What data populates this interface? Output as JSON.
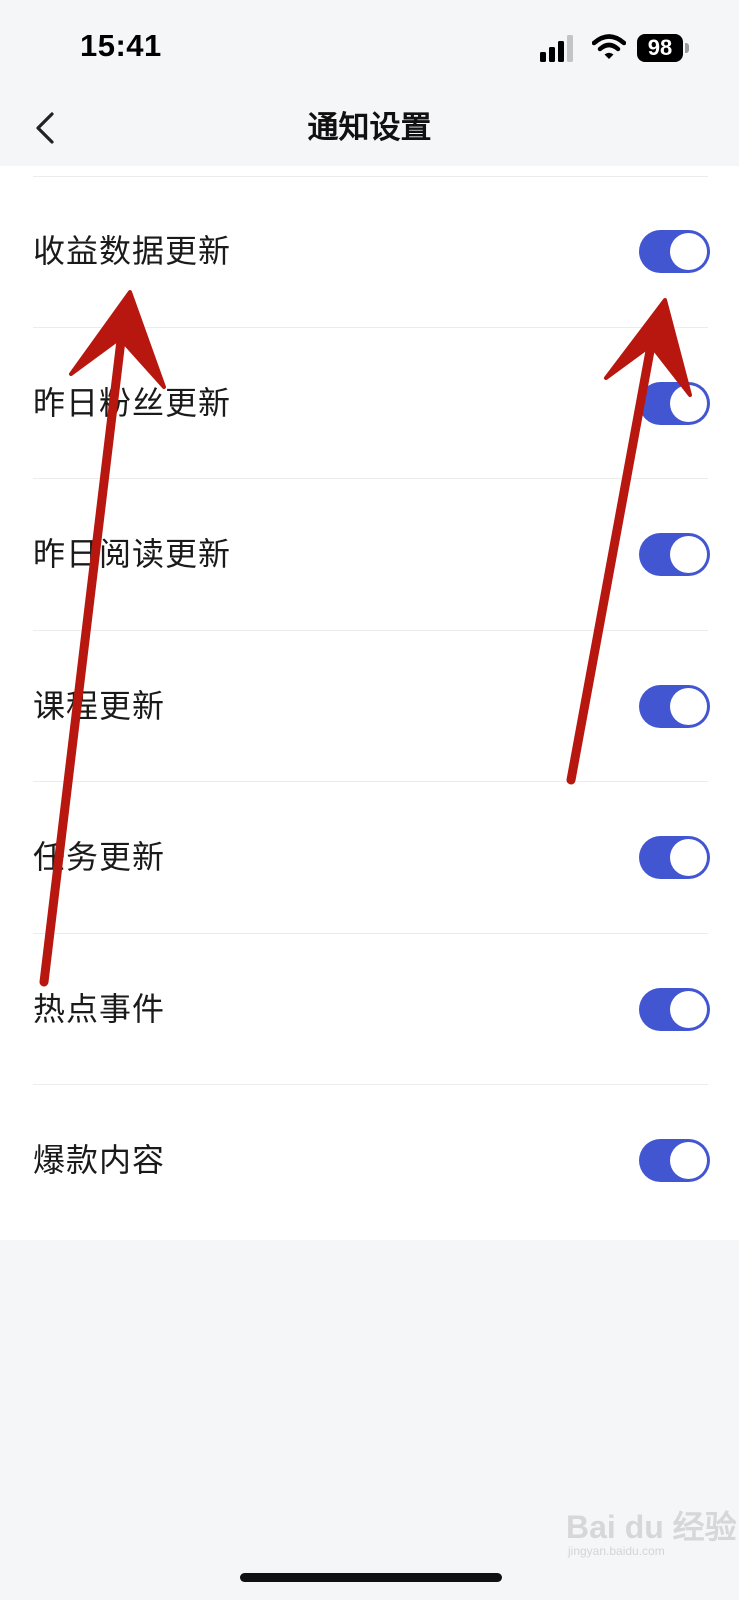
{
  "status_bar": {
    "time": "15:41",
    "battery_level": "98",
    "icons": [
      "signal-icon",
      "wifi-icon",
      "battery-icon"
    ]
  },
  "nav": {
    "title": "通知设置",
    "back_icon": "chevron-left-icon"
  },
  "settings": {
    "items": [
      {
        "label": "收益数据更新",
        "enabled": true
      },
      {
        "label": "昨日粉丝更新",
        "enabled": true
      },
      {
        "label": "昨日阅读更新",
        "enabled": true
      },
      {
        "label": "课程更新",
        "enabled": true
      },
      {
        "label": "任务更新",
        "enabled": true
      },
      {
        "label": "热点事件",
        "enabled": true
      },
      {
        "label": "爆款内容",
        "enabled": true
      }
    ]
  },
  "watermark": {
    "text": "Bai du 经验",
    "sub": "jingyan.baidu.com"
  },
  "colors": {
    "toggle_on": "#4356d2",
    "annotation_arrow": "#b8170f",
    "page_background": "#f5f6f8"
  }
}
